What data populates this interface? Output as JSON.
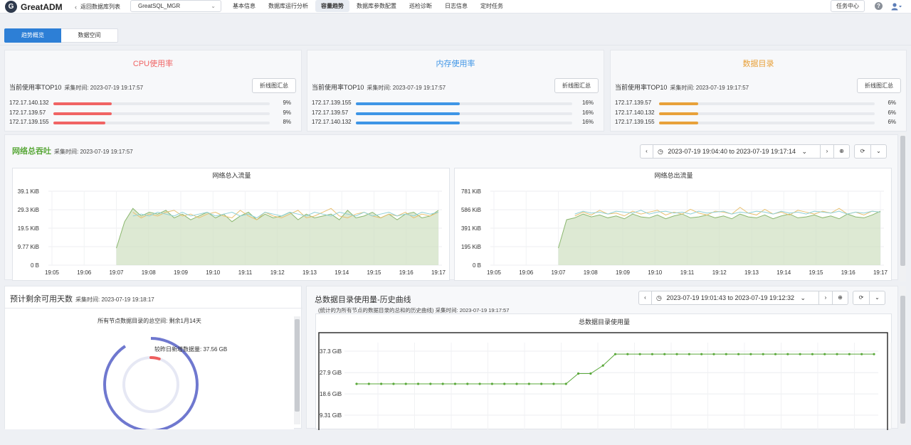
{
  "header": {
    "logo_mark": "G",
    "app_title": "GreatADM",
    "back_label": "返回数据库列表",
    "db_selected": "GreatSQL_MGR",
    "nav": [
      "基本信息",
      "数据库运行分析",
      "容量趋势",
      "数据库参数配置",
      "巡检诊断",
      "日志信息",
      "定时任务"
    ],
    "nav_active_index": 2,
    "task_center": "任务中心",
    "help_glyph": "?",
    "user_glyph": "▾"
  },
  "subtabs": [
    "趋势概览",
    "数据空间"
  ],
  "metrics": [
    {
      "title": "CPU使用率",
      "color": "#f06464",
      "subtitle": "当前使用率TOP10",
      "timestamp": "采集时间: 2023-07-19 19:17:57",
      "button": "折线图汇总",
      "rows": [
        {
          "ip": "172.17.140.132",
          "pct": "9%",
          "value": 0.09
        },
        {
          "ip": "172.17.139.57",
          "pct": "9%",
          "value": 0.09
        },
        {
          "ip": "172.17.139.155",
          "pct": "8%",
          "value": 0.08
        }
      ]
    },
    {
      "title": "内存使用率",
      "color": "#3e95e6",
      "subtitle": "当前使用率TOP10",
      "timestamp": "采集时间: 2023-07-19 19:17:57",
      "button": "折线图汇总",
      "rows": [
        {
          "ip": "172.17.139.155",
          "pct": "16%",
          "value": 0.16
        },
        {
          "ip": "172.17.139.57",
          "pct": "16%",
          "value": 0.16
        },
        {
          "ip": "172.17.140.132",
          "pct": "16%",
          "value": 0.16
        }
      ]
    },
    {
      "title": "数据目录",
      "color": "#e8a13a",
      "subtitle": "当前使用率TOP10",
      "timestamp": "采集时间: 2023-07-19 19:17:57",
      "button": "折线图汇总",
      "rows": [
        {
          "ip": "172.17.139.57",
          "pct": "6%",
          "value": 0.06
        },
        {
          "ip": "172.17.140.132",
          "pct": "6%",
          "value": 0.06
        },
        {
          "ip": "172.17.139.155",
          "pct": "6%",
          "value": 0.06
        }
      ]
    }
  ],
  "network": {
    "title": "网络总吞吐",
    "title_color": "#5aa83a",
    "timestamp": "采集时间: 2023-07-19 19:17:57",
    "range": "2023-07-19 19:04:40 to 2023-07-19 19:17:14",
    "prev": "‹",
    "next": "›",
    "caret": "⌄",
    "zoom_glyph": "⊕",
    "refresh_glyph": "⟳",
    "clock_glyph": "◷"
  },
  "chart_data": [
    {
      "type": "area",
      "title": "网络总入流量",
      "ylabel_ticks": [
        "0 B",
        "9.77 KiB",
        "19.5 KiB",
        "29.3 KiB",
        "39.1 KiB"
      ],
      "x": [
        "19:05",
        "19:06",
        "19:07",
        "19:08",
        "19:09",
        "19:10",
        "19:11",
        "19:12",
        "19:13",
        "19:14",
        "19:15",
        "19:16",
        "19:17"
      ],
      "ylim": [
        0,
        39.1
      ],
      "unit": "KiB",
      "series": [
        {
          "color": "#8cb870",
          "values": [
            9,
            23,
            30,
            26,
            28,
            27,
            29,
            25,
            27,
            24,
            26,
            28,
            25,
            27,
            23,
            26,
            28,
            24,
            27,
            25,
            26,
            28,
            24,
            27,
            25,
            26,
            27,
            24,
            29,
            25,
            26,
            28,
            25,
            27,
            24,
            27,
            28,
            25,
            26,
            29
          ]
        },
        {
          "color": "#e8c070",
          "values": [
            null,
            null,
            28,
            25,
            27,
            26,
            28,
            29,
            26,
            27,
            25,
            27,
            28,
            26,
            25,
            29,
            26,
            24,
            28,
            26,
            25,
            27,
            29,
            25,
            26,
            28,
            30,
            26,
            25,
            27,
            28,
            26,
            25,
            27,
            26,
            28,
            25,
            27,
            26,
            28
          ]
        },
        {
          "color": "#8fd0d6",
          "values": [
            null,
            null,
            26,
            27,
            26,
            28,
            27,
            26,
            28,
            26,
            27,
            28,
            26,
            27,
            28,
            26,
            27,
            25,
            28,
            27,
            26,
            28,
            27,
            26,
            28,
            27,
            26,
            28,
            27,
            26,
            28,
            26,
            27,
            28,
            26,
            27,
            26,
            28,
            27,
            28
          ]
        }
      ]
    },
    {
      "type": "area",
      "title": "网络总出流量",
      "ylabel_ticks": [
        "0 B",
        "195 KiB",
        "391 KiB",
        "586 KiB",
        "781 KiB"
      ],
      "x": [
        "19:05",
        "19:06",
        "19:07",
        "19:08",
        "19:09",
        "19:10",
        "19:11",
        "19:12",
        "19:13",
        "19:14",
        "19:15",
        "19:16",
        "19:17"
      ],
      "ylim": [
        0,
        781
      ],
      "unit": "KiB",
      "series": [
        {
          "color": "#8cb870",
          "values": [
            180,
            480,
            500,
            540,
            510,
            530,
            500,
            520,
            490,
            540,
            510,
            500,
            530,
            490,
            520,
            540,
            500,
            510,
            530,
            500,
            520,
            490,
            540,
            510,
            500,
            530,
            490,
            520,
            540,
            500,
            510,
            530,
            500,
            520,
            490,
            540,
            510,
            500,
            530,
            570
          ]
        },
        {
          "color": "#e8c070",
          "values": [
            null,
            null,
            520,
            560,
            530,
            580,
            540,
            550,
            520,
            570,
            540,
            560,
            580,
            530,
            560,
            540,
            590,
            550,
            530,
            570,
            560,
            540,
            610,
            550,
            530,
            590,
            540,
            560,
            530,
            580,
            560,
            540,
            570,
            550,
            600,
            540,
            560,
            530,
            570,
            560
          ]
        },
        {
          "color": "#8fd0d6",
          "values": [
            null,
            null,
            540,
            570,
            550,
            560,
            540,
            570,
            560,
            550,
            580,
            540,
            560,
            570,
            550,
            560,
            540,
            570,
            550,
            560,
            570,
            540,
            560,
            550,
            570,
            560,
            540,
            570,
            550,
            560,
            540,
            570,
            560,
            550,
            570,
            540,
            560,
            550,
            570,
            560
          ]
        }
      ]
    },
    {
      "type": "line",
      "title": "总数据目录使用量",
      "ylabel_ticks": [
        "9.31 GiB",
        "18.6 GiB",
        "27.9 GiB",
        "37.3 GiB"
      ],
      "unit": "GiB",
      "series": [
        {
          "color": "#5aa83a",
          "values": [
            23,
            23,
            23,
            23,
            23,
            23,
            23,
            23,
            23,
            23,
            23,
            23,
            23,
            23,
            23,
            23,
            23,
            23,
            27.5,
            27.5,
            31,
            36,
            36,
            36,
            36,
            36,
            36,
            36,
            36,
            36,
            36,
            36,
            36,
            36,
            36,
            36,
            36,
            36,
            36,
            36,
            36,
            36,
            36
          ]
        }
      ]
    }
  ],
  "remaining": {
    "title": "预计剩余可用天数",
    "timestamp": "采集时间: 2023-07-19 19:18:17",
    "total_label": "所有节点数据目录的总空间: 剩余1月14天",
    "new_label": "较昨日新增数据量: 37.56 GB"
  },
  "history": {
    "title": "总数据目录使用量-历史曲线",
    "note": "(统计的为所有节点的数据目录的总和的历史曲线) 采集时间: 2023-07-19 19:17:57",
    "range": "2023-07-19 19:01:43 to 2023-07-19 19:12:32"
  }
}
